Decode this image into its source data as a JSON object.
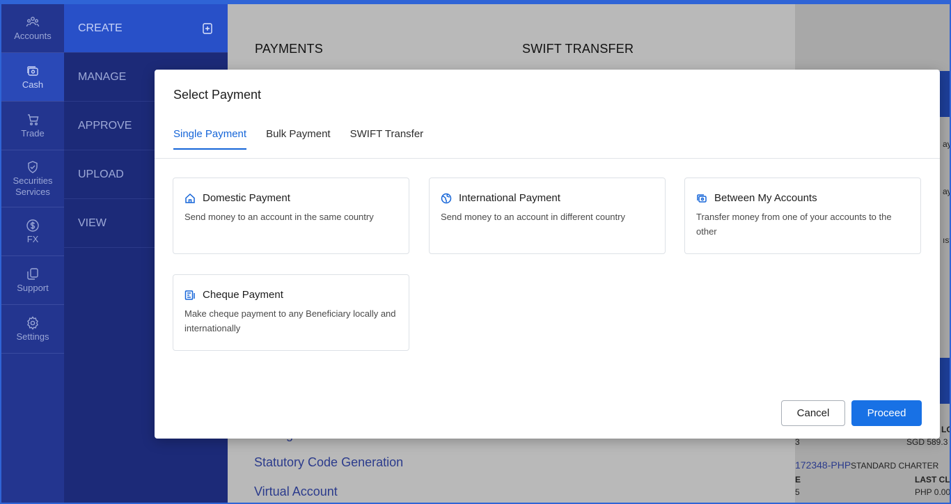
{
  "rail": [
    {
      "label": "Accounts",
      "icon": "accounts-icon"
    },
    {
      "label": "Cash",
      "icon": "cash-icon"
    },
    {
      "label": "Trade",
      "icon": "cart-icon"
    },
    {
      "label": "Securities Services",
      "icon": "shield-icon"
    },
    {
      "label": "FX",
      "icon": "dollar-icon"
    },
    {
      "label": "Support",
      "icon": "support-icon"
    },
    {
      "label": "Settings",
      "icon": "gear-icon"
    }
  ],
  "subnav": [
    "CREATE",
    "MANAGE",
    "APPROVE",
    "UPLOAD",
    "VIEW"
  ],
  "main": {
    "heading_left": "PAYMENTS",
    "heading_right": "SWIFT TRANSFER",
    "list": [
      "ID Registerations",
      "Statutory Code Generation",
      "Virtual Account"
    ]
  },
  "right_panel": {
    "texts": [
      "ayı",
      "ay",
      "ıst",
      "LO",
      "3",
      "SGD 589.3",
      "STANDARD CHARTER",
      "E",
      "LAST CLO",
      "5",
      "PHP 0.00"
    ],
    "account_link": "172348-PHP"
  },
  "modal": {
    "title": "Select Payment",
    "tabs": [
      "Single Payment",
      "Bulk Payment",
      "SWIFT Transfer"
    ],
    "active_tab": "Single Payment",
    "cards": [
      {
        "title": "Domestic Payment",
        "desc": "Send money to an account in the same country",
        "icon": "home-icon"
      },
      {
        "title": "International Payment",
        "desc": "Send money to an account in different country",
        "icon": "globe-icon"
      },
      {
        "title": "Between My Accounts",
        "desc": "Transfer money from one of your accounts to the other",
        "icon": "wallet-icon"
      },
      {
        "title": "Cheque Payment",
        "desc": "Make cheque payment to any Beneficiary locally and internationally",
        "icon": "cheque-icon"
      }
    ],
    "cancel_label": "Cancel",
    "proceed_label": "Proceed"
  },
  "colors": {
    "accent": "#1565d8",
    "rail": "#23358f",
    "subnav": "#1c2a78",
    "proceed": "#1871e5"
  }
}
